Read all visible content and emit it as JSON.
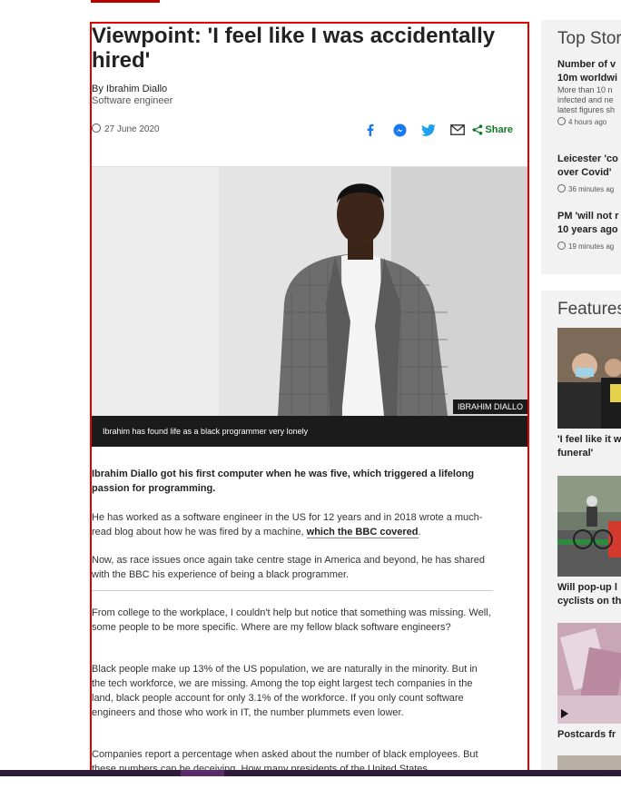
{
  "article": {
    "headline": "Viewpoint: 'I feel like I was accidentally hired'",
    "author": "By Ibrahim Diallo",
    "author_role": "Software engineer",
    "date": "27 June 2020",
    "share_label": "Share",
    "share_icons": [
      "facebook-icon",
      "messenger-icon",
      "twitter-icon",
      "email-icon",
      "share-icon"
    ],
    "photo_credit": "IBRAHIM DIALLO",
    "caption": "Ibrahim has found life as a black programmer very lonely",
    "lead": "Ibrahim Diallo got his first computer when he was five, which triggered a lifelong passion for programming.",
    "p1_text": "He has worked as a software engineer in the US for 12 years and in 2018 wrote a much-read blog about how he was fired by a machine, ",
    "p1_link": "which the BBC covered",
    "p1_end": ".",
    "p2": "Now, as race issues once again take centre stage in America and beyond, he has shared with the BBC his experience of being a black programmer.",
    "p3": "From college to the workplace, I couldn't help but notice that something was missing. Well, some people to be more specific. Where are my fellow black software engineers?",
    "p4": "Black people make up 13% of the US population, we are naturally in the minority. But in the tech workforce, we are missing. Among the top eight largest tech companies in the land, black people account for only 3.1% of the workforce. If you only count software engineers and those who work in IT, the number plummets even lower.",
    "p5": "Companies report a percentage when asked about the number of black employees. But these numbers can be deceiving. How many presidents of the United States"
  },
  "sidebar": {
    "top_stories_title": "Top Stori",
    "stories": [
      {
        "title_l1": "Number of v",
        "title_l2": "10m worldwi",
        "summary": [
          "More than 10 n",
          "infected and ne",
          "latest figures sh"
        ],
        "time": "4 hours ago"
      },
      {
        "title_l1": "Leicester 'co",
        "title_l2": "over Covid'",
        "summary": [],
        "time": "36 minutes ag"
      },
      {
        "title_l1": "PM 'will not r",
        "title_l2": "10 years ago",
        "summary": [],
        "time": "19 minutes ag"
      }
    ],
    "features_title": "Features",
    "features": [
      {
        "l1": "'I feel like it w",
        "l2": "funeral'"
      },
      {
        "l1": "Will pop-up l",
        "l2": "cyclists on th"
      },
      {
        "l1": "Postcards fr",
        "l2": ""
      }
    ]
  },
  "colors": {
    "accent_red": "#b80000",
    "share_green": "#117a28",
    "facebook_blue": "#1877f2",
    "twitter_blue": "#1da1f2",
    "bottom_bar": "#2f1b3a"
  }
}
